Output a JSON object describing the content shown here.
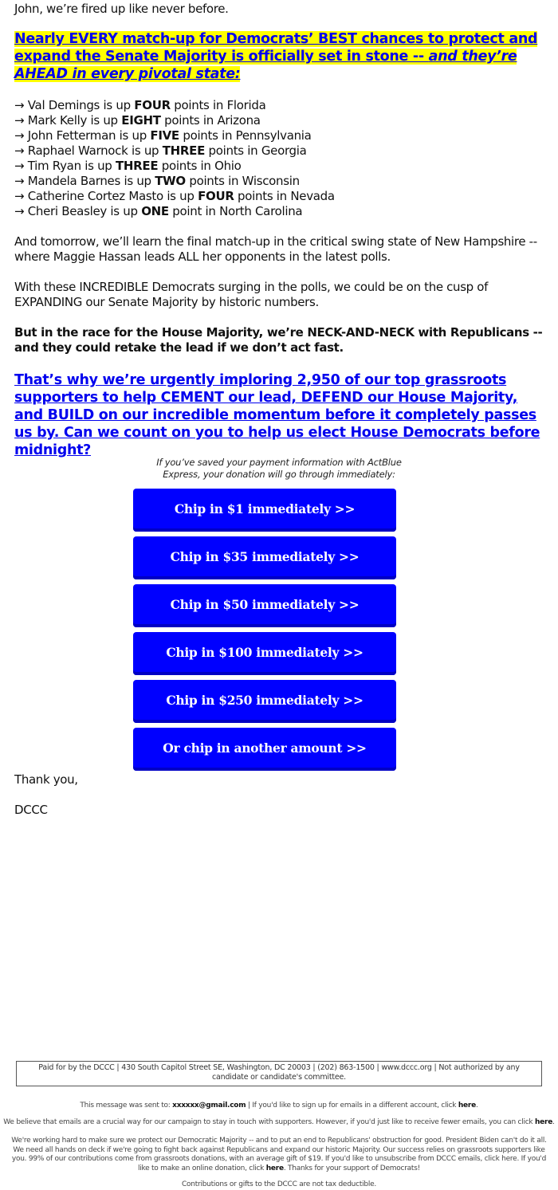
{
  "greeting": "John, we’re fired up like never before.",
  "headline": {
    "text_main": "Nearly EVERY match-up for Democrats’ BEST chances to protect and expand the Senate Majority is officially set in stone -- ",
    "text_italic": "and they’re AHEAD in every pivotal state:",
    "highlight_color": "#ffff00",
    "link_color": "#0000ee"
  },
  "polls": [
    {
      "arrow": "→",
      "pre": "Val Demings is up ",
      "margin": "FOUR",
      "post": " points in Florida"
    },
    {
      "arrow": "→",
      "pre": "Mark Kelly is up ",
      "margin": "EIGHT",
      "post": " points in Arizona"
    },
    {
      "arrow": "→",
      "pre": "John Fetterman is up ",
      "margin": "FIVE",
      "post": " points in Pennsylvania"
    },
    {
      "arrow": "→",
      "pre": "Raphael Warnock is up ",
      "margin": "THREE",
      "post": " points in Georgia"
    },
    {
      "arrow": "→",
      "pre": "Tim Ryan is up ",
      "margin": "THREE",
      "post": " points in Ohio"
    },
    {
      "arrow": "→",
      "pre": "Mandela Barnes is up ",
      "margin": "TWO",
      "post": " points in Wisconsin"
    },
    {
      "arrow": "→",
      "pre": "Catherine Cortez Masto is up ",
      "margin": "FOUR",
      "post": " points in Nevada"
    },
    {
      "arrow": "→",
      "pre": "Cheri Beasley is up ",
      "margin": "ONE",
      "post": " point in North Carolina"
    }
  ],
  "paragraphs": {
    "new_hampshire": "And tomorrow, we’ll learn the final match-up in the critical swing state of New Hampshire -- where Maggie Hassan leads ALL her opponents in the latest polls.",
    "expanding": "With these INCREDIBLE Democrats surging in the polls, we could be on the cusp of EXPANDING our Senate Majority by historic numbers.",
    "house_race": "But in the race for the House Majority, we’re NECK-AND-NECK with Republicans -- and they could retake the lead if we don’t act fast."
  },
  "cta_link": "That’s why we’re urgently imploring 2,950 of our top grassroots supporters to help CEMENT our lead, DEFEND our House Majority, and BUILD on our incredible momentum before it completely passes us by. Can we count on you to help us elect House Democrats before midnight?",
  "express_note": {
    "line1": "If you’ve saved your payment information with ActBlue",
    "line2": "Express, your donation will go through immediately:"
  },
  "donate_buttons": [
    {
      "label": "Chip in $1 immediately >>",
      "amount": "$1"
    },
    {
      "label": "Chip in $35 immediately >>",
      "amount": "$35"
    },
    {
      "label": "Chip in $50 immediately >>",
      "amount": "$50"
    },
    {
      "label": "Chip in $100 immediately >>",
      "amount": "$100"
    },
    {
      "label": "Chip in $250 immediately >>",
      "amount": "$250"
    },
    {
      "label": "Or chip in another amount >>",
      "amount": "other"
    }
  ],
  "button_color": "#0000ff",
  "closing": {
    "thanks": "Thank you,",
    "signature": "DCCC"
  },
  "footer": {
    "disclaimer": "Paid for by the DCCC | 430 South Capitol Street SE, Washington, DC 20003 | (202) 863-1500 | www.dccc.org | Not authorized by any candidate or candidate's committee.",
    "sent_to_prefix": "This message was sent to: ",
    "sent_to_email": "xxxxxx@gmail.com",
    "sent_to_suffix": " | If you'd like to sign up for emails in a different account, click ",
    "here": "here",
    "period": ".",
    "fewer_emails": "We believe that emails are a crucial way for our campaign to stay in touch with supporters. However, if you'd just like to receive fewer emails, you can click ",
    "mission_pre": "We're working hard to make sure we protect our Democratic Majority -- and to put an end to Republicans' obstruction for good. President Biden can't do it all. We need all hands on deck if we're going to fight back against Republicans and expand our historic Majority. Our success relies on grassroots supporters like you. 99% of our contributions come from grassroots donations, with an average gift of $19. If you'd like to unsubscribe from DCCC emails, click here. If you'd like to make an online donation, click ",
    "mission_post": ". Thanks for your support of Democrats!",
    "tax_note": "Contributions or gifts to the DCCC are not tax deductible."
  }
}
